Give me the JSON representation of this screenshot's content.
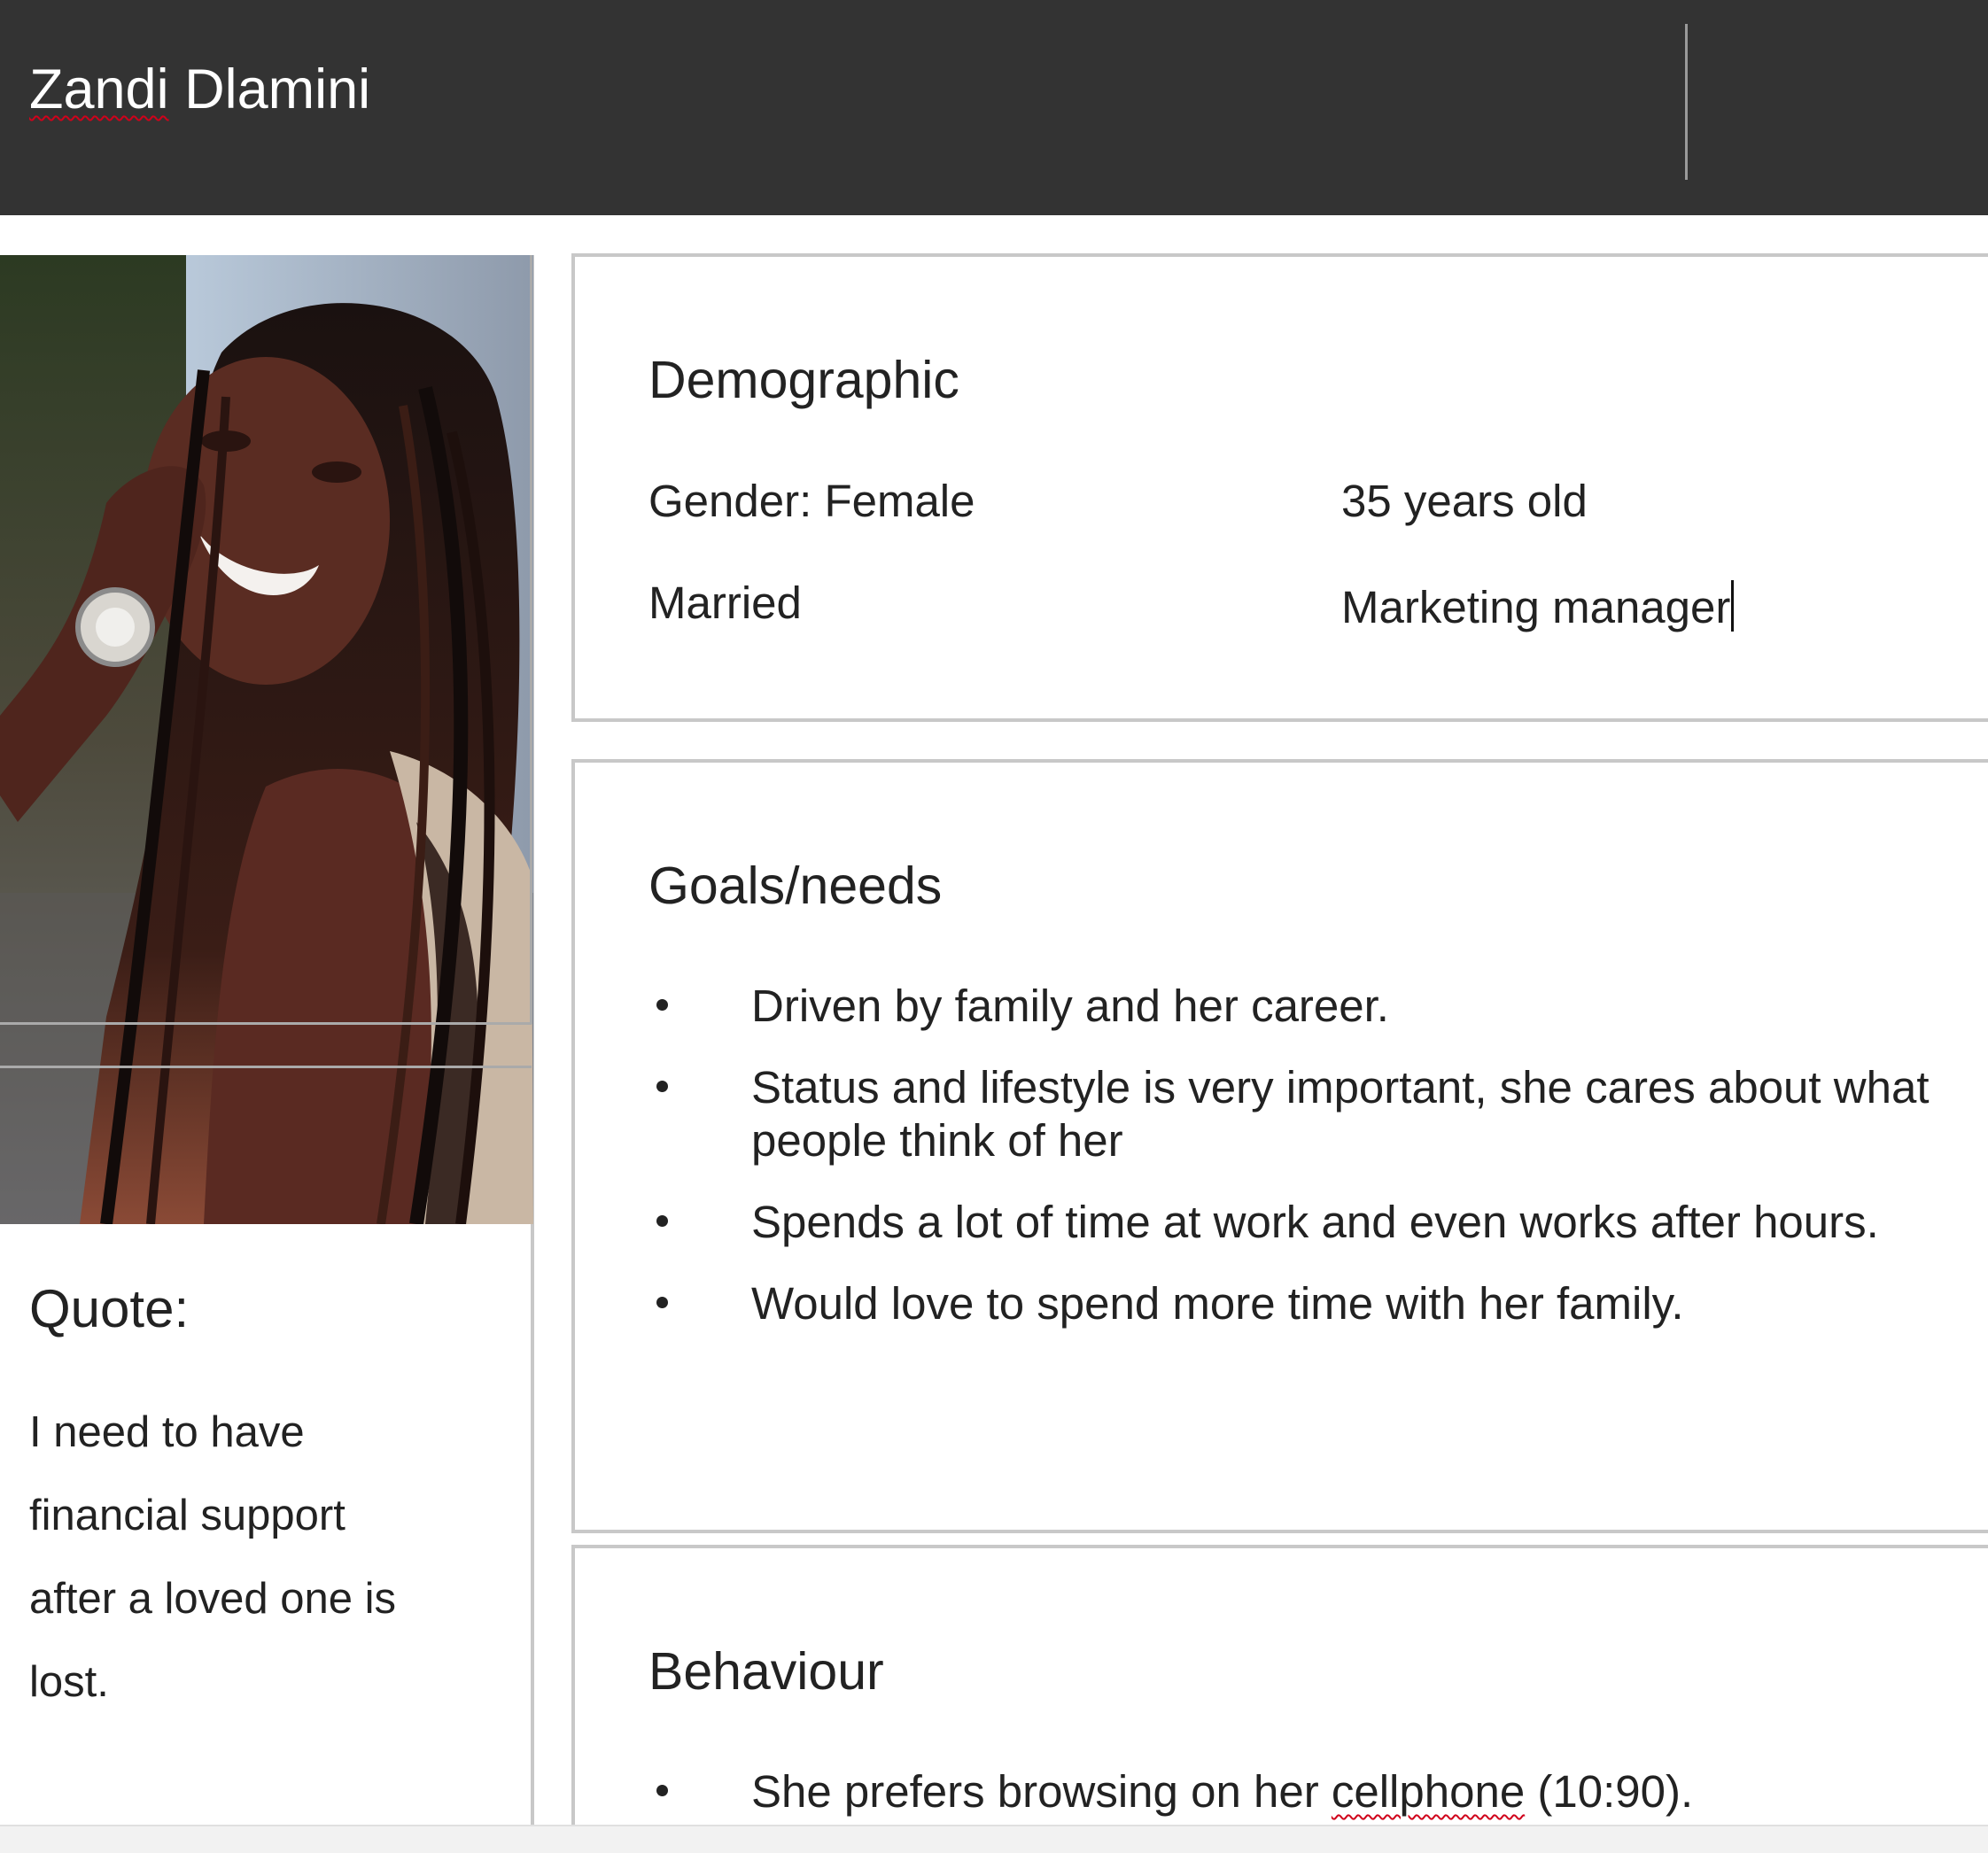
{
  "header": {
    "title_first": "Zandi",
    "title_last": "Dlamini"
  },
  "left": {
    "photo_alt": "portrait-photo",
    "quote_heading": "Quote:",
    "quote_lines": [
      "I need to have",
      "financial support",
      "after a loved one is",
      "lost."
    ]
  },
  "demographic": {
    "title": "Demographic",
    "gender": "Gender: Female",
    "age": "35 years old",
    "status": "Married",
    "job": "Marketing manager"
  },
  "goals": {
    "title": "Goals/needs",
    "items": [
      "Driven by family and her career.",
      "Status and lifestyle is very important, she cares about what people think of her",
      "Spends a lot of time at work and even works after hours.",
      "Would love to spend more time with her family."
    ]
  },
  "behaviour": {
    "title": "Behaviour",
    "item_before": "She prefers browsing on her ",
    "item_word": "cellphone",
    "item_after": " (10:90)."
  },
  "colors": {
    "header_bg": "#333333",
    "border": "#c8c8c8",
    "spellcheck": "#d0021b"
  }
}
